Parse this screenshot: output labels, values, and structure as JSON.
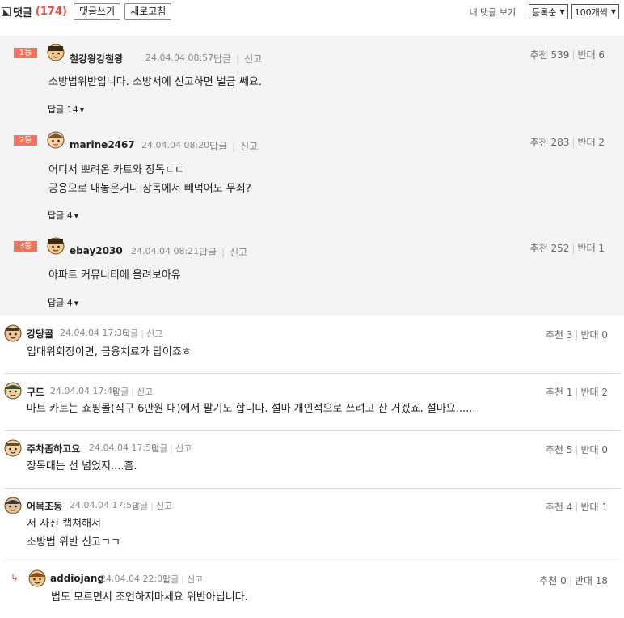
{
  "header": {
    "title": "댓글",
    "count": "(174)",
    "write_button": "댓글쓰기",
    "refresh_button": "새로고침",
    "my_comments_link": "내 댓글 보기",
    "sort_select": "등록순",
    "per_page_select": "100개씩"
  },
  "labels": {
    "reply": "답글",
    "report": "신고"
  },
  "best_comments": [
    {
      "rank": "1등",
      "nick": "철강왕강철왕",
      "time": "24.04.04 08:57",
      "up": "추천 539",
      "down": "반대 6",
      "lines": [
        "소방법위반입니다. 소방서에 신고하면 벌금 쎄요."
      ],
      "replies": "답글 14"
    },
    {
      "rank": "2등",
      "nick": "marine2467",
      "time": "24.04.04 08:20",
      "up": "추천 283",
      "down": "반대 2",
      "lines": [
        "어디서 뽀려온 카트와 장독ㄷㄷ",
        "공용으로 내놓은거니 장독에서 빼먹어도 무죄?"
      ],
      "replies": "답글 4"
    },
    {
      "rank": "3등",
      "nick": "ebay2030",
      "time": "24.04.04 08:21",
      "up": "추천 252",
      "down": "반대 1",
      "lines": [
        "아파트 커뮤니티에 올려보아유"
      ],
      "replies": "답글 4"
    }
  ],
  "comments": [
    {
      "nick": "강당골",
      "time": "24.04.04 17:36",
      "up": "추천 3",
      "down": "반대 0",
      "lines": [
        "입대위회장이면, 금융치료가 답이죠ㅎ"
      ]
    },
    {
      "nick": "구드",
      "time": "24.04.04 17:48",
      "up": "추천 1",
      "down": "반대 2",
      "lines": [
        "마트 카트는 쇼핑몰(직구 6만원 대)에서 팔기도 합니다. 설마 개인적으로 쓰려고 산 거겠죠. 설마요......"
      ]
    },
    {
      "nick": "주차좀하고요",
      "time": "24.04.04 17:50",
      "up": "추천 5",
      "down": "반대 0",
      "lines": [
        "장독대는 선 넘었지....흠."
      ]
    },
    {
      "nick": "어목조동",
      "time": "24.04.04 17:50",
      "up": "추천 4",
      "down": "반대 1",
      "lines": [
        "저 사진 캡쳐해서",
        "소방법 위반 신고ㄱㄱ"
      ]
    },
    {
      "nick": "addiojang",
      "time": "24.04.04 22:01",
      "up": "추천 0",
      "down": "반대 18",
      "lines": [
        "법도 모르면서 조언하지마세요 위반아닙니다."
      ]
    }
  ],
  "colors": {
    "accent": "#e8503a",
    "rank_badge": "#f0735f",
    "best_bg": "#f4f4f4"
  }
}
